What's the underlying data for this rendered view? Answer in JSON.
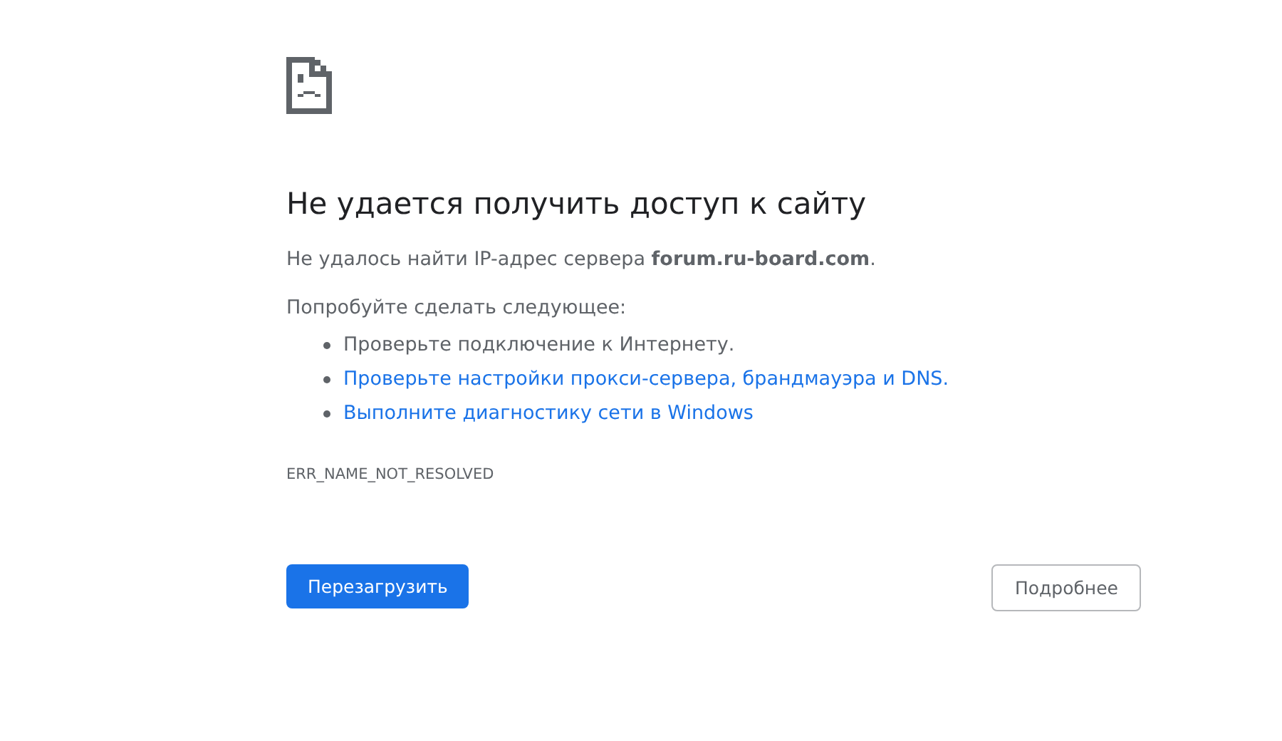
{
  "title": "Не удается получить доступ к сайту",
  "message": "Не удалось найти IP-адрес сервера **forum.ru-board.com**.",
  "suggestions_heading": "Попробуйте сделать следующее:",
  "suggestions": [
    {
      "kind": "text",
      "text": "Проверьте подключение к Интернету."
    },
    {
      "kind": "link",
      "text": "Проверьте настройки прокси-сервера, брандмауэра и DNS."
    },
    {
      "kind": "link",
      "text": "Выполните диагностику сети в Windows"
    }
  ],
  "error_code": "ERR_NAME_NOT_RESOLVED",
  "buttons": {
    "reload": "Перезагрузить",
    "details": "Подробнее"
  }
}
